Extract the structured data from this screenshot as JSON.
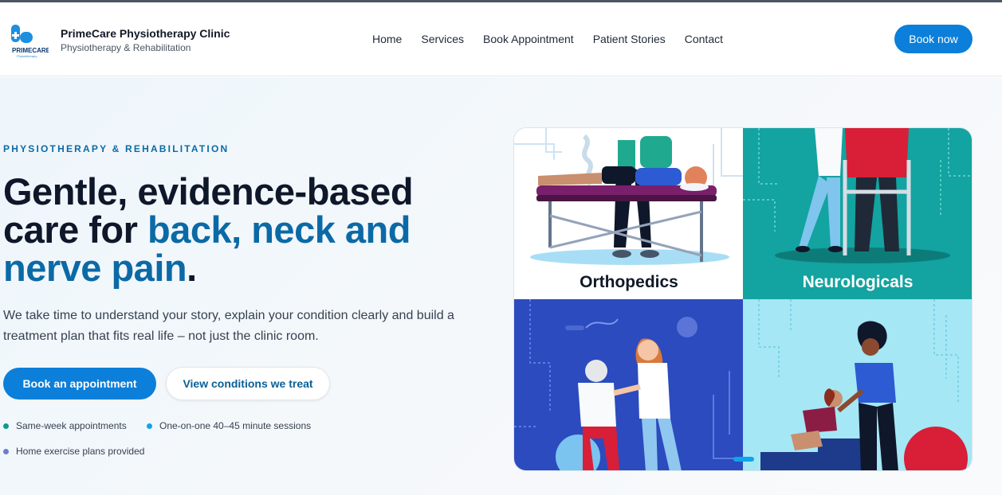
{
  "brand": {
    "name": "PrimeCare Physiotherapy Clinic",
    "tagline": "Physiotherapy & Rehabilitation",
    "logo_text": "PRIMECARE",
    "logo_subtext": "Physiotherapy"
  },
  "nav": {
    "items": [
      "Home",
      "Services",
      "Book Appointment",
      "Patient Stories",
      "Contact"
    ]
  },
  "header": {
    "cta_label": "Book now"
  },
  "hero": {
    "eyebrow": "PHYSIOTHERAPY & REHABILITATION",
    "headline_part1": "Gentle, evidence-based care for ",
    "headline_accent": "back, neck and nerve pain",
    "headline_end": ".",
    "description": "We take time to understand your story, explain your condition clearly and build a treatment plan that fits real life – not just the clinic room.",
    "primary_cta": "Book an appointment",
    "secondary_cta": "View conditions we treat",
    "features": [
      {
        "text": "Same-week appointments",
        "color": "#0f9b8e"
      },
      {
        "text": "One-on-one 40–45 minute sessions",
        "color": "#0ea5e9"
      },
      {
        "text": "Home exercise plans provided",
        "color": "#6b7fd1"
      }
    ]
  },
  "carousel": {
    "tiles": [
      {
        "label": "Orthopedics",
        "bg": "#ffffff",
        "label_color": "#111827"
      },
      {
        "label": "Neurologicals",
        "bg": "#13a3a0",
        "label_color": "#ffffff"
      },
      {
        "label": "",
        "bg": "#2b4bbf",
        "label_color": "#ffffff"
      },
      {
        "label": "",
        "bg": "#a5e7f5",
        "label_color": "#111827"
      }
    ],
    "active_index": 0
  },
  "colors": {
    "accent": "#0b6aa6",
    "button": "#0b7fd9",
    "indicator": "#0ea5e9"
  }
}
